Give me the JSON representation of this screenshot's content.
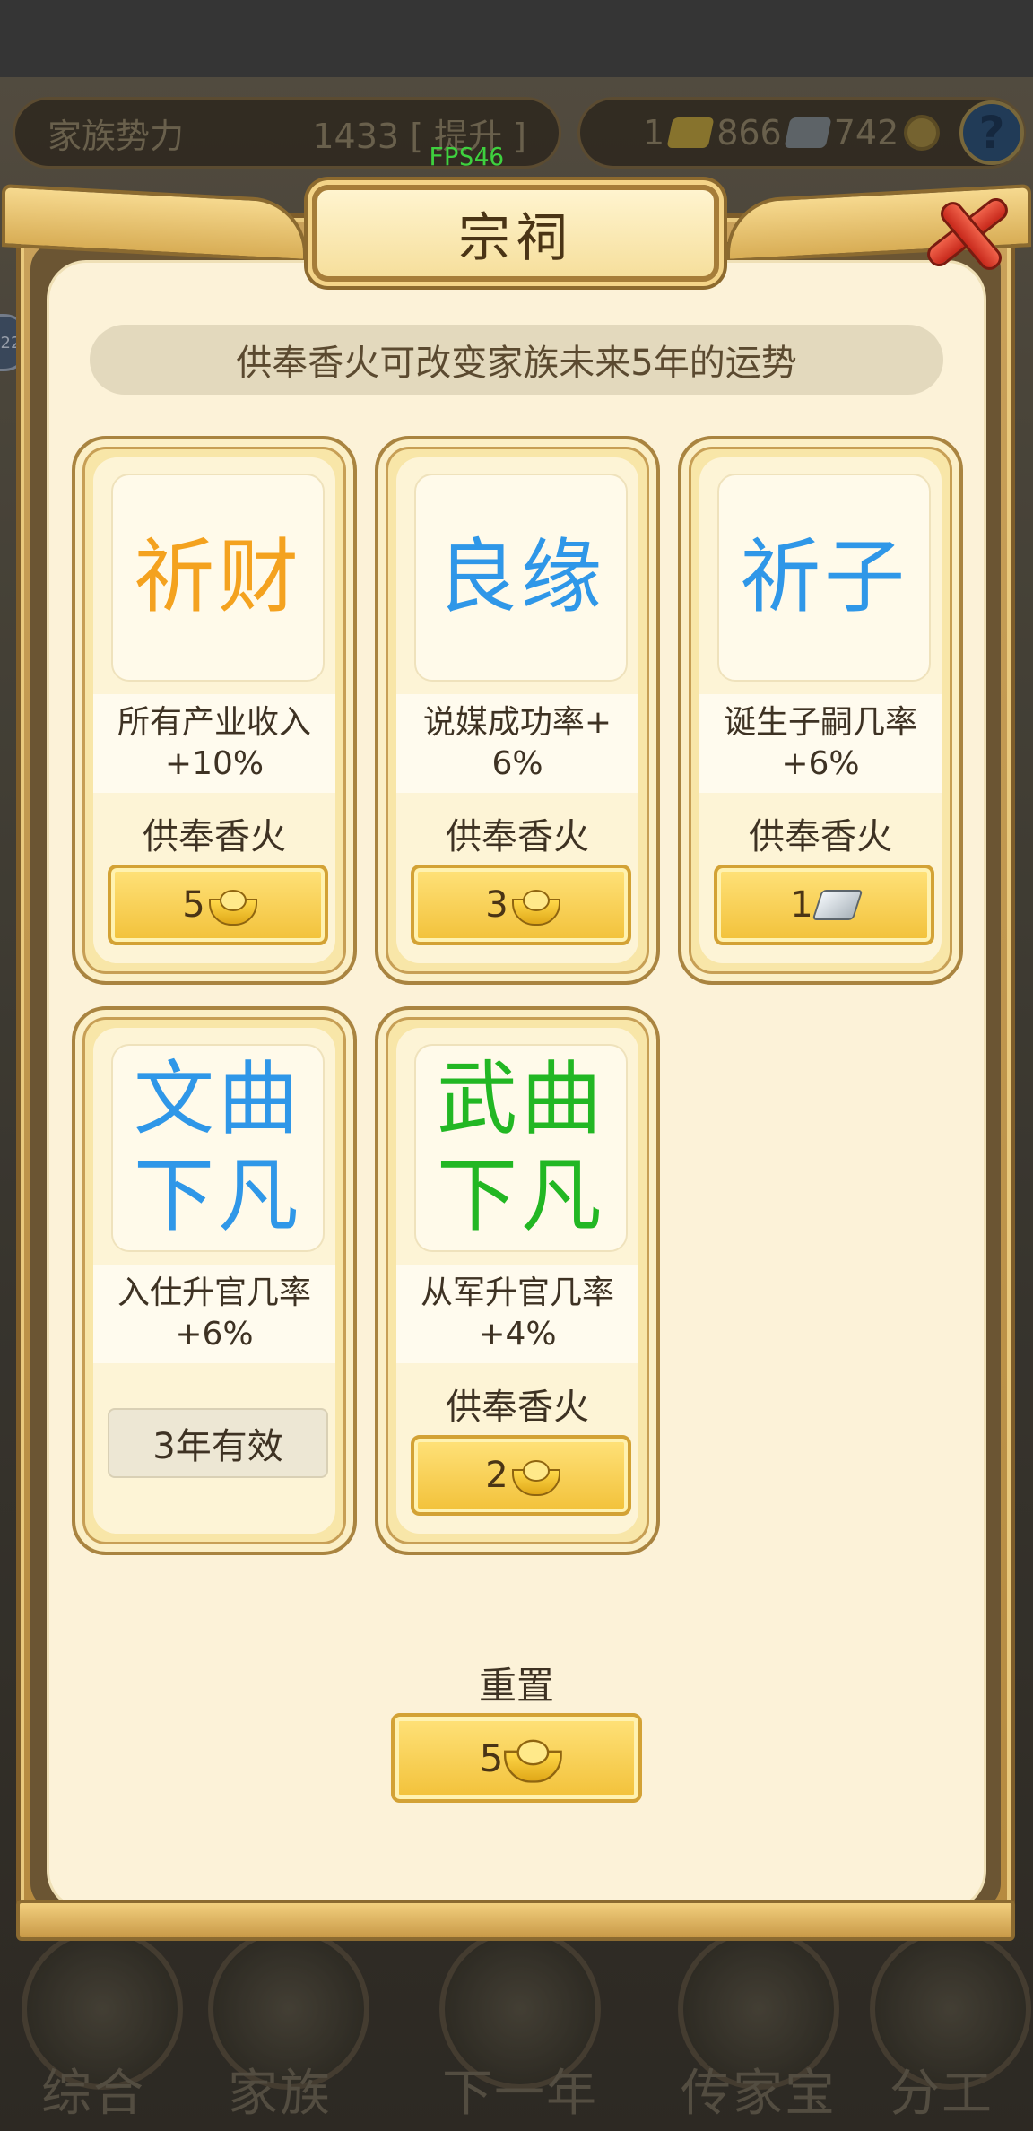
{
  "background": {
    "top_left": {
      "label": "家族势力",
      "value": "1433",
      "bracket_text": "[ 提升 ]"
    },
    "top_right": {
      "prefix": "1",
      "gold": "866",
      "silver": "742"
    },
    "fps": "FPS46",
    "side_badge": "22",
    "bottom_nav": [
      {
        "label": "综合",
        "icon": "scroll-icon"
      },
      {
        "label": "家族",
        "icon": "house-icon"
      },
      {
        "label": "下一年",
        "icon": "mountain-icon"
      },
      {
        "label": "传家宝",
        "icon": "jade-icon"
      },
      {
        "label": "分工",
        "icon": "people-icon"
      }
    ]
  },
  "modal": {
    "title": "宗祠",
    "notice": "供奉香火可改变家族未来5年的运势",
    "offer_label": "供奉香火",
    "cards": [
      {
        "name": "祈财",
        "color": "#f4a21f",
        "desc": "所有产业收入+10%",
        "price": "5",
        "currency": "gold-ingot"
      },
      {
        "name": "良缘",
        "color": "#2f97e8",
        "desc": "说媒成功率+6%",
        "price": "3",
        "currency": "gold-ingot"
      },
      {
        "name": "祈子",
        "color": "#2f97e8",
        "desc": "诞生子嗣几率+6%",
        "price": "1",
        "currency": "silver-bar"
      },
      {
        "name_line1": "文曲",
        "name_line2": "下凡",
        "color": "#2f97e8",
        "desc": "入仕升官几率+6%",
        "status": "3年有效"
      },
      {
        "name_line1": "武曲",
        "name_line2": "下凡",
        "color": "#22b723",
        "desc": "从军升官几率+4%",
        "price": "2",
        "currency": "gold-ingot"
      }
    ],
    "reset": {
      "label": "重置",
      "price": "5",
      "currency": "gold-ingot"
    }
  }
}
